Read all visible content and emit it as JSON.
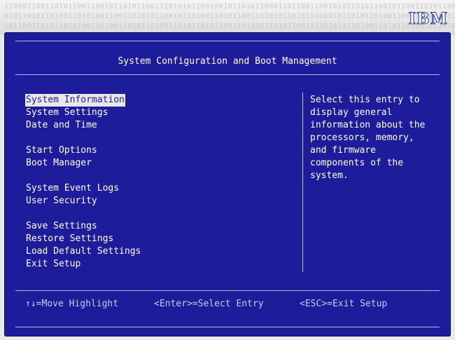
{
  "banner": {
    "logo": "IBM",
    "binary_lines": [
      "110001100110101100110010110101100111010101100100101101011000110110011001010110101100101100110101100110101101010011010110",
      "010110101101001101010011001101010110010110100110101100110101011010110100101101011010011001101011001010110010110101001101",
      "101100110101101010011010011010110100110101101011001101010110101100101101010110100110101101001011010110100101101011010010"
    ]
  },
  "screen": {
    "title": "System Configuration and Boot Management",
    "menu_groups": [
      [
        {
          "label": "System Information",
          "selected": true
        },
        {
          "label": "System Settings"
        },
        {
          "label": "Date and Time"
        }
      ],
      [
        {
          "label": "Start Options"
        },
        {
          "label": "Boot Manager"
        }
      ],
      [
        {
          "label": "System Event Logs"
        },
        {
          "label": "User Security"
        }
      ],
      [
        {
          "label": "Save Settings"
        },
        {
          "label": "Restore Settings"
        },
        {
          "label": "Load Default Settings"
        },
        {
          "label": "Exit Setup"
        }
      ]
    ],
    "help_lines": [
      "Select this entry to",
      "display general",
      "information about the",
      "processors, memory,",
      "and firmware",
      "components of the",
      "system."
    ],
    "footer": {
      "move_highlight": "↑↓=Move Highlight",
      "select_entry": "<Enter>=Select Entry",
      "exit_setup": "<ESC>=Exit Setup"
    }
  },
  "colors": {
    "screen_bg": "#1d1c9a",
    "text": "#ffffff",
    "highlight_bg": "#e8e8e8",
    "logo": "#2b3f8f"
  }
}
